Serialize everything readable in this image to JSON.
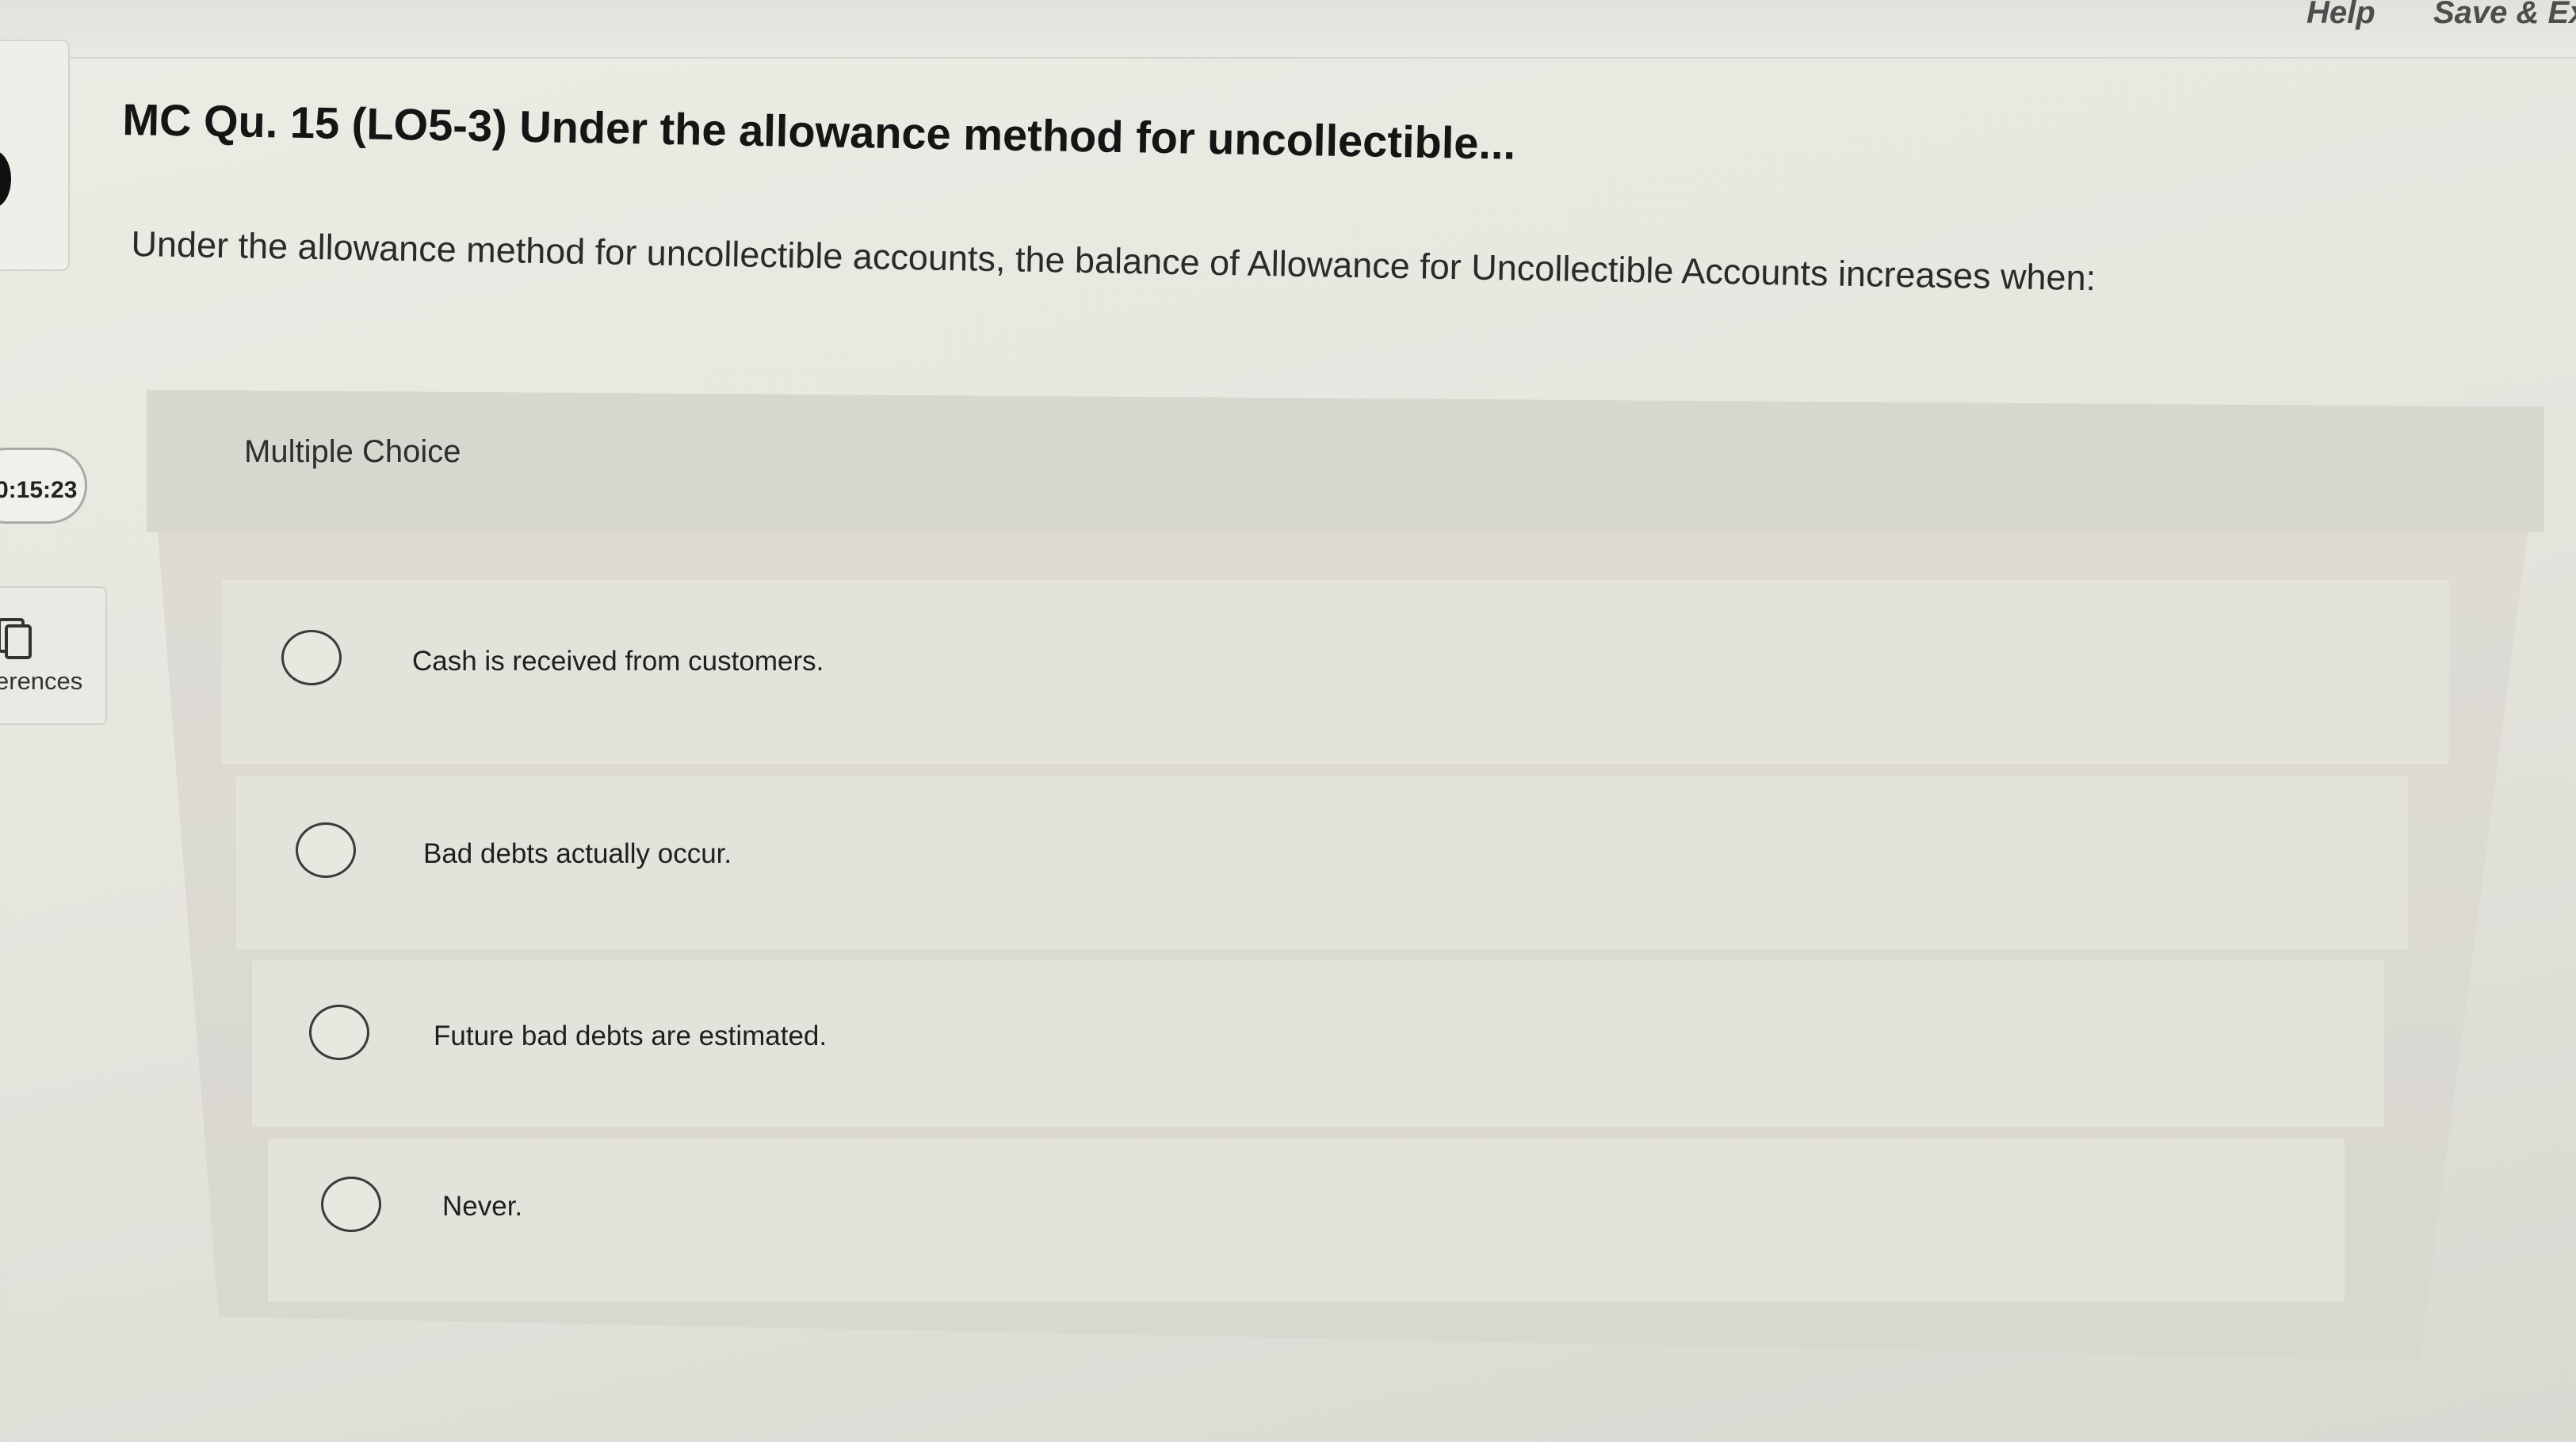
{
  "topbar": {
    "help_label": "Help",
    "save_label": "Save & Ex"
  },
  "sidebar": {
    "timer": "0:15:23",
    "references_label": "erences"
  },
  "question": {
    "title": "MC Qu. 15 (LO5-3) Under the allowance method for uncollectible...",
    "text": "Under the allowance method for uncollectible accounts, the balance of Allowance for Uncollectible Accounts increases when:"
  },
  "multiple_choice": {
    "label": "Multiple Choice",
    "options": [
      {
        "label": "Cash is received from customers.",
        "selected": false
      },
      {
        "label": "Bad debts actually occur.",
        "selected": false
      },
      {
        "label": "Future bad debts are estimated.",
        "selected": false
      },
      {
        "label": "Never.",
        "selected": false
      }
    ]
  },
  "icons": {
    "references": "references-icon"
  }
}
